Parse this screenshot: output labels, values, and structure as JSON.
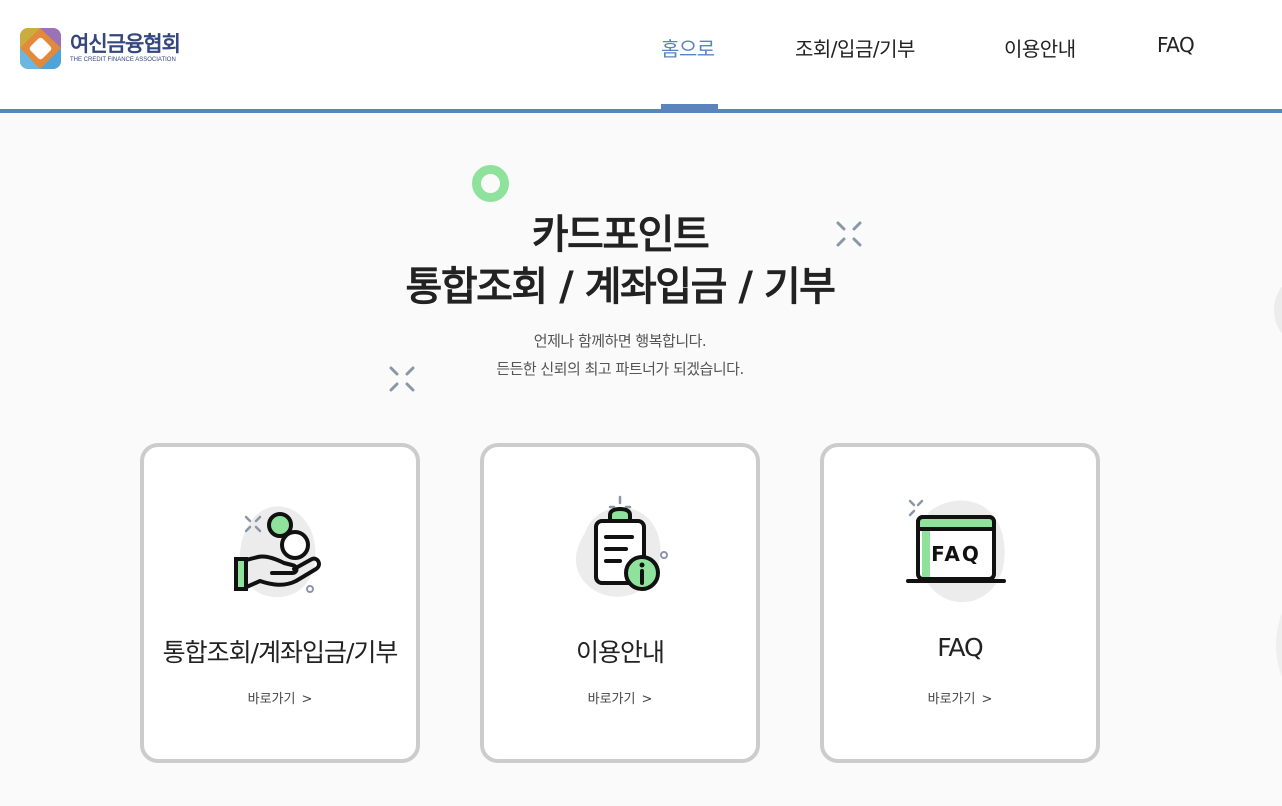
{
  "header": {
    "logo_ko": "여신금융협회",
    "logo_en": "THE CREDIT FINANCE ASSOCIATION",
    "nav": [
      {
        "label": "홈으로",
        "active": true
      },
      {
        "label": "조회/입금/기부",
        "active": false
      },
      {
        "label": "이용안내",
        "active": false
      },
      {
        "label": "FAQ",
        "active": false
      }
    ]
  },
  "hero": {
    "title_line1": "카드포인트",
    "title_line2": "통합조회 / 계좌입금 / 기부",
    "sub_line1": "언제나 함께하면 행복합니다.",
    "sub_line2": "든든한 신뢰의 최고 파트너가 되겠습니다."
  },
  "cards": [
    {
      "title": "통합조회/계좌입금/기부",
      "link": "바로가기",
      "icon": "coins-hand-icon"
    },
    {
      "title": "이용안내",
      "link": "바로가기",
      "icon": "clipboard-info-icon"
    },
    {
      "title": "FAQ",
      "link": "바로가기",
      "icon": "faq-board-icon"
    }
  ],
  "icon_faq_text": "FAQ",
  "colors": {
    "accent": "#5b84bd",
    "green": "#8fe29c",
    "brand": "#34477e"
  }
}
